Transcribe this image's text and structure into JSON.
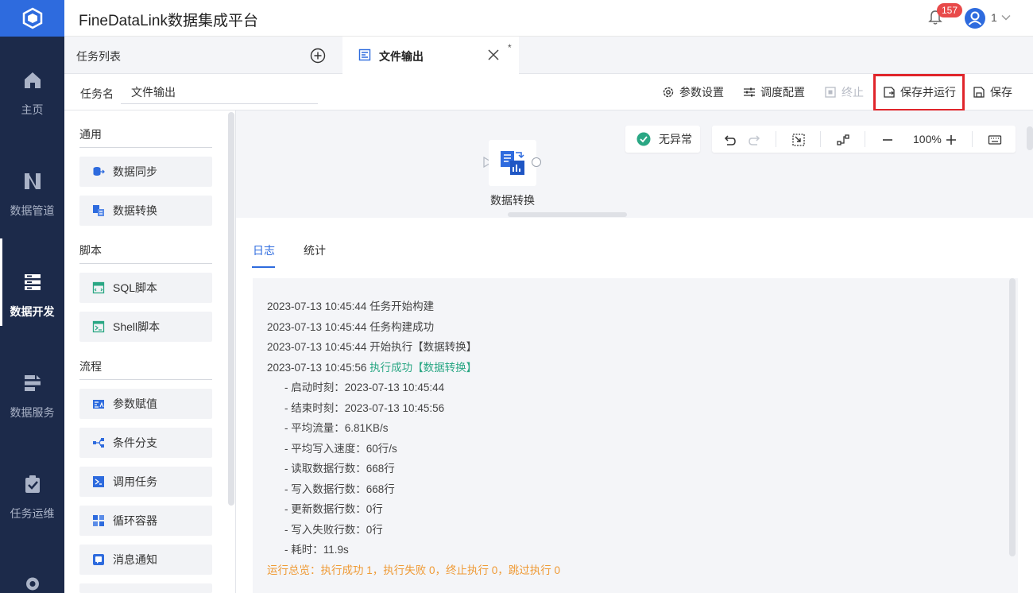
{
  "app": {
    "title": "FineDataLink数据集成平台"
  },
  "nav": {
    "items": [
      {
        "label": "主页",
        "icon": "home-icon"
      },
      {
        "label": "数据管道",
        "icon": "pipeline-icon"
      },
      {
        "label": "数据开发",
        "icon": "dev-icon",
        "active": true
      },
      {
        "label": "数据服务",
        "icon": "service-icon"
      },
      {
        "label": "任务运维",
        "icon": "ops-icon"
      },
      {
        "label": "",
        "icon": "gear-icon"
      }
    ]
  },
  "header": {
    "notification_count": "157",
    "user_name": "1"
  },
  "tabs": {
    "list_label": "任务列表",
    "open_tab_label": "文件输出",
    "modified_mark": "*"
  },
  "toolbar": {
    "task_name_label": "任务名",
    "task_name_value": "文件输出",
    "params_label": "参数设置",
    "schedule_label": "调度配置",
    "stop_label": "终止",
    "save_run_label": "保存并运行",
    "save_label": "保存"
  },
  "palette": {
    "sections": [
      {
        "title": "通用",
        "items": [
          "数据同步",
          "数据转换"
        ]
      },
      {
        "title": "脚本",
        "items": [
          "SQL脚本",
          "Shell脚本"
        ]
      },
      {
        "title": "流程",
        "items": [
          "参数赋值",
          "条件分支",
          "调用任务",
          "循环容器",
          "消息通知"
        ]
      }
    ]
  },
  "canvas": {
    "status_label": "无异常",
    "zoom": "100%",
    "node_label": "数据转换"
  },
  "log": {
    "tabs": [
      "日志",
      "统计"
    ],
    "lines": [
      "2023-07-13 10:45:44 任务开始构建",
      "2023-07-13 10:45:44 任务构建成功",
      "2023-07-13 10:45:44 开始执行【数据转换】"
    ],
    "success_time": "2023-07-13 10:45:56",
    "success_text": "执行成功【数据转换】",
    "details": [
      "- 启动时刻：2023-07-13 10:45:44",
      "- 结束时刻：2023-07-13 10:45:56",
      "- 平均流量：6.81KB/s",
      "- 平均写入速度：60行/s",
      "- 读取数据行数：668行",
      "- 写入数据行数：668行",
      "- 更新数据行数：0行",
      "- 写入失败行数：0行",
      "- 耗时：11.9s"
    ],
    "summary": "运行总览：执行成功 1，执行失败 0，终止执行 0，跳过执行 0"
  },
  "colors": {
    "accent": "#2e6bde",
    "nav_bg": "#1c2a4a",
    "success": "#2aa784",
    "warning": "#ef9a35",
    "highlight": "#e0252b"
  }
}
